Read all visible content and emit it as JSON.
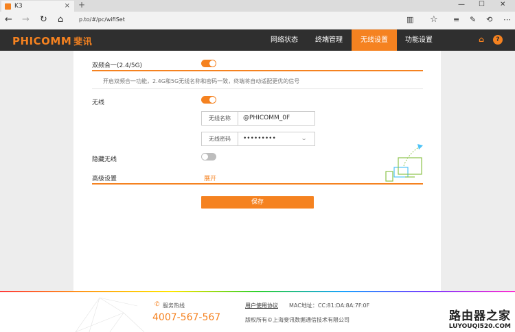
{
  "browser": {
    "tab_title": "K3",
    "tab_close": "×",
    "new_tab": "+",
    "url": "p.to/#/pc/wifiSet",
    "icons": [
      "back-icon",
      "forward-icon",
      "refresh-icon",
      "home-icon",
      "reading-view-icon",
      "favorite-icon",
      "hub-icon",
      "notes-icon",
      "share-icon",
      "more-icon"
    ]
  },
  "header": {
    "logo": "PHICOMM",
    "logo_cn": "斐讯",
    "nav": [
      {
        "label": "网络状态"
      },
      {
        "label": "终端管理"
      },
      {
        "label": "无线设置"
      },
      {
        "label": "功能设置"
      }
    ],
    "active_index": 2
  },
  "wifi": {
    "dual_band_label": "双频合一(2.4/5G)",
    "dual_band_on": true,
    "dual_band_desc": "开启双频合一功能，2.4G和5G无线名称和密码一致，终端将自动适配更优的信号",
    "wireless_label": "无线",
    "wireless_on": true,
    "ssid_label": "无线名称",
    "ssid_value": "@PHICOMM_0F",
    "password_label": "无线密码",
    "password_value": "•••••••••",
    "hidden_label": "隐藏无线",
    "hidden_on": false,
    "advanced_label": "高级设置",
    "expand_label": "展开",
    "save_label": "保存"
  },
  "footer": {
    "hotline_label": "服务热线",
    "hotline": "4007-567-567",
    "agreement": "用户使用协议",
    "mac": "MAC地址：CC:81:DA:8A:7F:0F",
    "copyright": "版权所有©上海斐讯数据通信技术有限公司"
  },
  "watermark": {
    "title": "路由器之家",
    "site": "LUYOUQI520.COM"
  },
  "colors": {
    "accent": "#f58220",
    "nav_bg": "#2f2f2f"
  }
}
